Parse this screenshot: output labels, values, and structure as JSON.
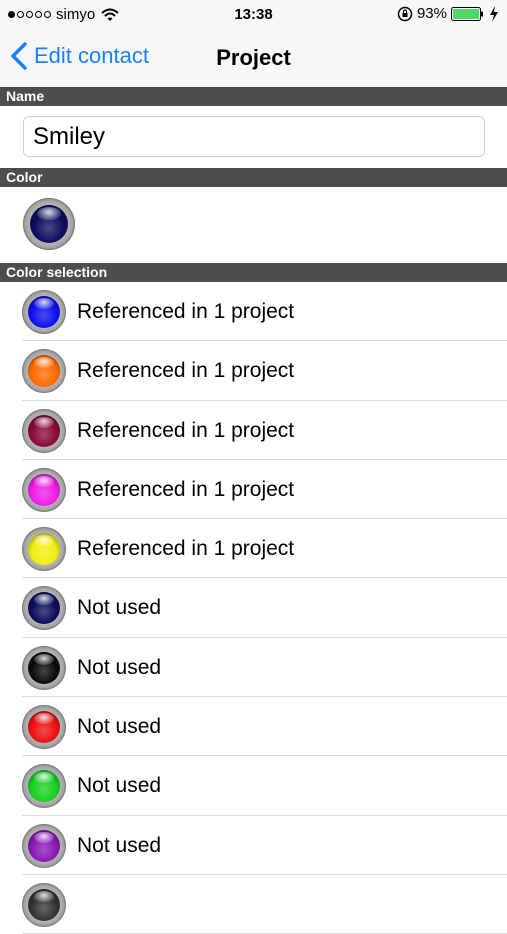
{
  "status_bar": {
    "carrier": "simyo",
    "time": "13:38",
    "battery_percent": "93%",
    "icons": [
      "signal-dots-icon",
      "wifi-icon",
      "rotation-lock-icon",
      "battery-icon",
      "charging-icon"
    ]
  },
  "nav": {
    "back_label": "Edit contact",
    "title": "Project"
  },
  "sections": {
    "name": "Name",
    "color": "Color",
    "color_selection": "Color selection"
  },
  "name_field": {
    "value": "Smiley"
  },
  "current_color": "#0d0d5e",
  "colors": [
    {
      "label": "Referenced in 1 project",
      "color": "#1010ee",
      "name": "blue"
    },
    {
      "label": "Referenced in 1 project",
      "color": "#ff6a00",
      "name": "orange"
    },
    {
      "label": "Referenced in 1 project",
      "color": "#8a0a3a",
      "name": "maroon"
    },
    {
      "label": "Referenced in 1 project",
      "color": "#ee1ee8",
      "name": "magenta"
    },
    {
      "label": "Referenced in 1 project",
      "color": "#f0ee10",
      "name": "yellow"
    },
    {
      "label": "Not used",
      "color": "#0d0d5e",
      "name": "navy"
    },
    {
      "label": "Not used",
      "color": "#0a0a0a",
      "name": "black"
    },
    {
      "label": "Not used",
      "color": "#ee1010",
      "name": "red"
    },
    {
      "label": "Not used",
      "color": "#18d020",
      "name": "green"
    },
    {
      "label": "Not used",
      "color": "#8a18b8",
      "name": "purple"
    },
    {
      "label": "",
      "color": "#333333",
      "name": "partial"
    }
  ]
}
